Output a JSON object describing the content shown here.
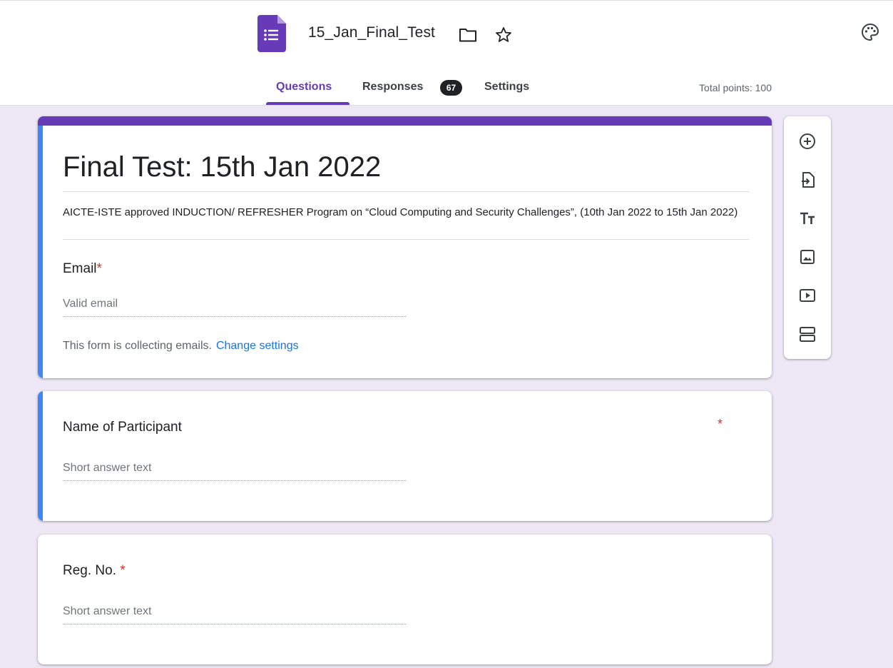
{
  "header": {
    "doc_title": "15_Jan_Final_Test",
    "tabs": [
      {
        "label": "Questions"
      },
      {
        "label": "Responses"
      },
      {
        "label": "Settings"
      }
    ],
    "responses_count": "67",
    "total_points": "Total points: 100"
  },
  "form": {
    "title": "Final Test: 15th Jan 2022",
    "description": "AICTE-ISTE approved INDUCTION/ REFRESHER Program on “Cloud Computing and Security Challenges”,  (10th Jan 2022 to 15th Jan 2022)",
    "email": {
      "label": "Email",
      "required_mark": "*",
      "placeholder": "Valid email",
      "note": "This form is collecting emails.",
      "link": "Change settings"
    }
  },
  "questions": [
    {
      "label": "Name of Participant",
      "required_mark": "*",
      "answer_placeholder": "Short answer text"
    },
    {
      "label": "Reg. No.",
      "required_mark": "*",
      "answer_placeholder": "Short answer text"
    }
  ],
  "toolbar": {
    "icons": [
      "add-question-icon",
      "import-questions-icon",
      "add-title-icon",
      "add-image-icon",
      "add-video-icon",
      "add-section-icon"
    ]
  },
  "colors": {
    "accent": "#673ab7",
    "selected_bar": "#4285f4",
    "background": "#ede7f6",
    "required": "#d93025",
    "link": "#1a73e8"
  }
}
